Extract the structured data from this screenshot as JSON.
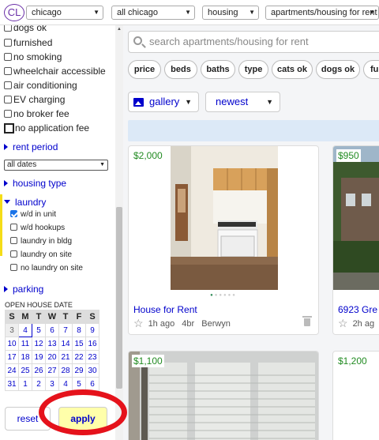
{
  "topbar": {
    "logo": "CL",
    "location": "chicago",
    "area": "all chicago",
    "category": "housing",
    "subcategory": "apartments/housing for rent"
  },
  "sidebar": {
    "top_filters": [
      {
        "label": "dogs ok",
        "checked": false
      },
      {
        "label": "furnished",
        "checked": false
      },
      {
        "label": "no smoking",
        "checked": false
      },
      {
        "label": "wheelchair accessible",
        "checked": false
      },
      {
        "label": "air conditioning",
        "checked": false
      },
      {
        "label": "EV charging",
        "checked": false
      },
      {
        "label": "no broker fee",
        "checked": false
      },
      {
        "label": "no application fee",
        "checked": false,
        "focused": true
      }
    ],
    "rent_period": "rent period",
    "dates_value": "all dates",
    "housing_type": "housing type",
    "laundry": "laundry",
    "laundry_options": [
      {
        "label": "w/d in unit",
        "checked": true
      },
      {
        "label": "w/d hookups",
        "checked": false
      },
      {
        "label": "laundry in bldg",
        "checked": false
      },
      {
        "label": "laundry on site",
        "checked": false
      },
      {
        "label": "no laundry on site",
        "checked": false
      }
    ],
    "parking": "parking",
    "open_house_label": "OPEN HOUSE DATE",
    "calendar": {
      "days": [
        "S",
        "M",
        "T",
        "W",
        "T",
        "F",
        "S"
      ],
      "weeks": [
        [
          "3",
          "4",
          "5",
          "6",
          "7",
          "8",
          "9"
        ],
        [
          "10",
          "11",
          "12",
          "13",
          "14",
          "15",
          "16"
        ],
        [
          "17",
          "18",
          "19",
          "20",
          "21",
          "22",
          "23"
        ],
        [
          "24",
          "25",
          "26",
          "27",
          "28",
          "29",
          "30"
        ],
        [
          "31",
          "1",
          "2",
          "3",
          "4",
          "5",
          "6"
        ]
      ]
    },
    "reset_label": "reset",
    "apply_label": "apply"
  },
  "main": {
    "search_placeholder": "search apartments/housing for rent",
    "chips": [
      "price",
      "beds",
      "baths",
      "type",
      "cats ok",
      "dogs ok",
      "fu"
    ],
    "view_mode": "gallery",
    "sort": "newest",
    "listings": [
      {
        "price": "$2,000",
        "title": "House for Rent",
        "age": "1h ago",
        "beds": "4br",
        "location": "Berwyn"
      },
      {
        "price": "$950",
        "title": "6923 Gre",
        "age": "2h ag",
        "beds": "",
        "location": ""
      },
      {
        "price": "$1,100",
        "title": "",
        "age": "",
        "beds": "",
        "location": ""
      },
      {
        "price": "$1,200",
        "title": "",
        "age": "",
        "beds": "",
        "location": ""
      }
    ]
  },
  "colors": {
    "accent": "#6a2fa8",
    "link": "#0000cc",
    "price": "#228b22",
    "annotation": "#e5121b",
    "apply_bg": "#ffffaa"
  }
}
